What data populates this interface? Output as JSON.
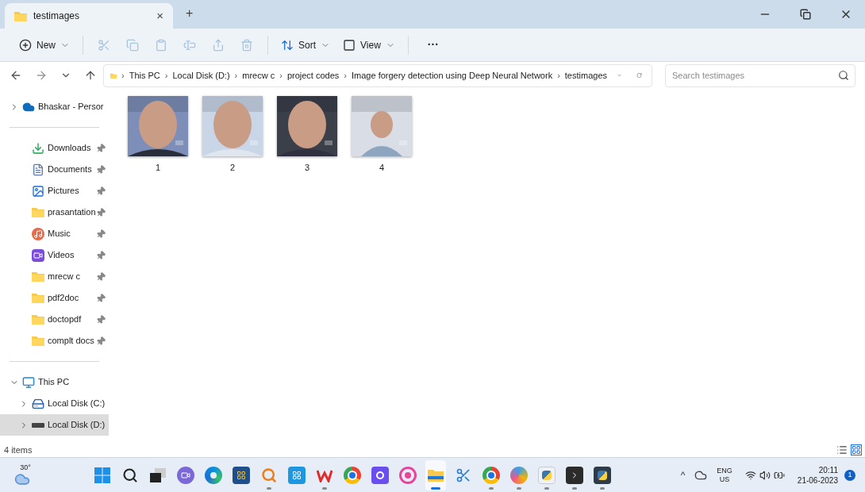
{
  "window": {
    "tab_title": "testimages",
    "tab_close": "×",
    "new_tab": "+"
  },
  "toolbar": {
    "items": [
      {
        "kind": "new",
        "label": "New",
        "disabled": false
      },
      {
        "kind": "cut",
        "disabled": true
      },
      {
        "kind": "copy",
        "disabled": true
      },
      {
        "kind": "paste",
        "disabled": true
      },
      {
        "kind": "rename",
        "disabled": true
      },
      {
        "kind": "share",
        "disabled": true
      },
      {
        "kind": "delete",
        "disabled": true
      },
      {
        "kind": "sort",
        "label": "Sort",
        "disabled": false
      },
      {
        "kind": "view",
        "label": "View",
        "disabled": false
      },
      {
        "kind": "more",
        "label": "···",
        "disabled": false
      }
    ]
  },
  "address": {
    "crumbs": [
      "This PC",
      "Local Disk (D:)",
      "mrecw c",
      "project codes",
      "Image forgery detection using Deep Neural Network",
      "testimages"
    ],
    "separator": "›"
  },
  "search": {
    "placeholder": "Search testimages"
  },
  "sidebar": {
    "items": [
      {
        "kind": "onedrive",
        "label": "Bhaskar - Persor",
        "expanded": false,
        "selected": false
      },
      {
        "kind": "divider"
      },
      {
        "kind": "downloads",
        "label": "Downloads",
        "pinned": true,
        "selected": false
      },
      {
        "kind": "documents",
        "label": "Documents",
        "pinned": true,
        "selected": false
      },
      {
        "kind": "pictures",
        "label": "Pictures",
        "pinned": true,
        "selected": false
      },
      {
        "kind": "folder",
        "label": "prasantation",
        "pinned": true,
        "selected": false
      },
      {
        "kind": "music",
        "label": "Music",
        "pinned": true,
        "selected": false
      },
      {
        "kind": "videos",
        "label": "Videos",
        "pinned": true,
        "selected": false
      },
      {
        "kind": "folder",
        "label": "mrecw c",
        "pinned": true,
        "selected": false
      },
      {
        "kind": "folder",
        "label": "pdf2doc",
        "pinned": true,
        "selected": false
      },
      {
        "kind": "folder",
        "label": "doctopdf",
        "pinned": true,
        "selected": false
      },
      {
        "kind": "folder",
        "label": "complt docs",
        "pinned": true,
        "selected": false
      },
      {
        "kind": "divider"
      },
      {
        "kind": "thispc",
        "label": "This PC",
        "expanded": true,
        "selected": false,
        "children": [
          {
            "kind": "disk_c",
            "label": "Local Disk (C:)",
            "expanded": false,
            "selected": false
          },
          {
            "kind": "disk_d",
            "label": "Local Disk (D:)",
            "expanded": false,
            "selected": true
          }
        ]
      }
    ]
  },
  "files": [
    {
      "name": "1",
      "kind": "picture"
    },
    {
      "name": "2",
      "kind": "picture"
    },
    {
      "name": "3",
      "kind": "picture"
    },
    {
      "name": "4",
      "kind": "picture"
    }
  ],
  "status_bar": {
    "count": "4 items"
  },
  "taskbar": {
    "weather": "30°",
    "apps": [
      {
        "kind": "start",
        "running": false,
        "active": false
      },
      {
        "kind": "search",
        "running": false,
        "active": false
      },
      {
        "kind": "taskview",
        "running": false,
        "active": false
      },
      {
        "kind": "chat",
        "running": false,
        "active": false
      },
      {
        "kind": "edge",
        "running": false,
        "active": false
      },
      {
        "kind": "store",
        "running": false,
        "active": false
      },
      {
        "kind": "magnifier",
        "running": true,
        "active": false
      },
      {
        "kind": "calendar",
        "running": false,
        "active": false
      },
      {
        "kind": "wps",
        "running": true,
        "active": false
      },
      {
        "kind": "chrome",
        "running": false,
        "active": false
      },
      {
        "kind": "purple",
        "running": false,
        "active": false
      },
      {
        "kind": "pink",
        "running": false,
        "active": false
      },
      {
        "kind": "explorer",
        "running": true,
        "active": true
      },
      {
        "kind": "snip",
        "running": false,
        "active": false
      },
      {
        "kind": "chrome_profile",
        "running": true,
        "active": false
      },
      {
        "kind": "paint",
        "running": true,
        "active": false
      },
      {
        "kind": "pyfile",
        "running": true,
        "active": false
      },
      {
        "kind": "terminal",
        "running": true,
        "active": false
      },
      {
        "kind": "idle",
        "running": true,
        "active": false
      }
    ],
    "tray": {
      "overflow": "^",
      "lang": "ENG",
      "region": "US",
      "time": "20:11",
      "date": "21-06-2023",
      "notifications": "1"
    }
  }
}
